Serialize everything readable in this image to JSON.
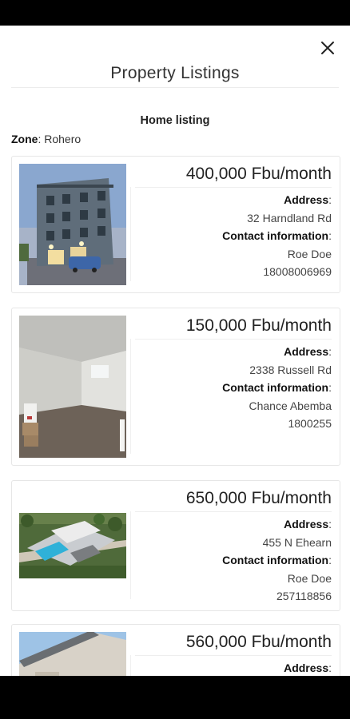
{
  "header": {
    "title": "Property Listings",
    "close_icon": "close-icon"
  },
  "section": {
    "heading": "Home listing",
    "zone_label": "Zone",
    "zone_value": "Rohero"
  },
  "labels": {
    "address": "Address",
    "contact": "Contact information",
    "colon": ":"
  },
  "listings": [
    {
      "price": "400,000 Fbu/month",
      "address": "32 Harndland Rd",
      "contact_name": "Roe Doe",
      "phone": "18008006969",
      "photo_icon": "apartment-building-photo"
    },
    {
      "price": "150,000 Fbu/month",
      "address": "2338 Russell Rd",
      "contact_name": "Chance Abemba",
      "phone": "1800255",
      "photo_icon": "empty-room-photo"
    },
    {
      "price": "650,000 Fbu/month",
      "address": "455 N Ehearn",
      "contact_name": "Roe Doe",
      "phone": "257118856",
      "photo_icon": "aerial-villa-photo"
    },
    {
      "price": "560,000 Fbu/month",
      "address": "",
      "contact_name": "",
      "phone": "",
      "photo_icon": "house-roof-photo"
    }
  ]
}
